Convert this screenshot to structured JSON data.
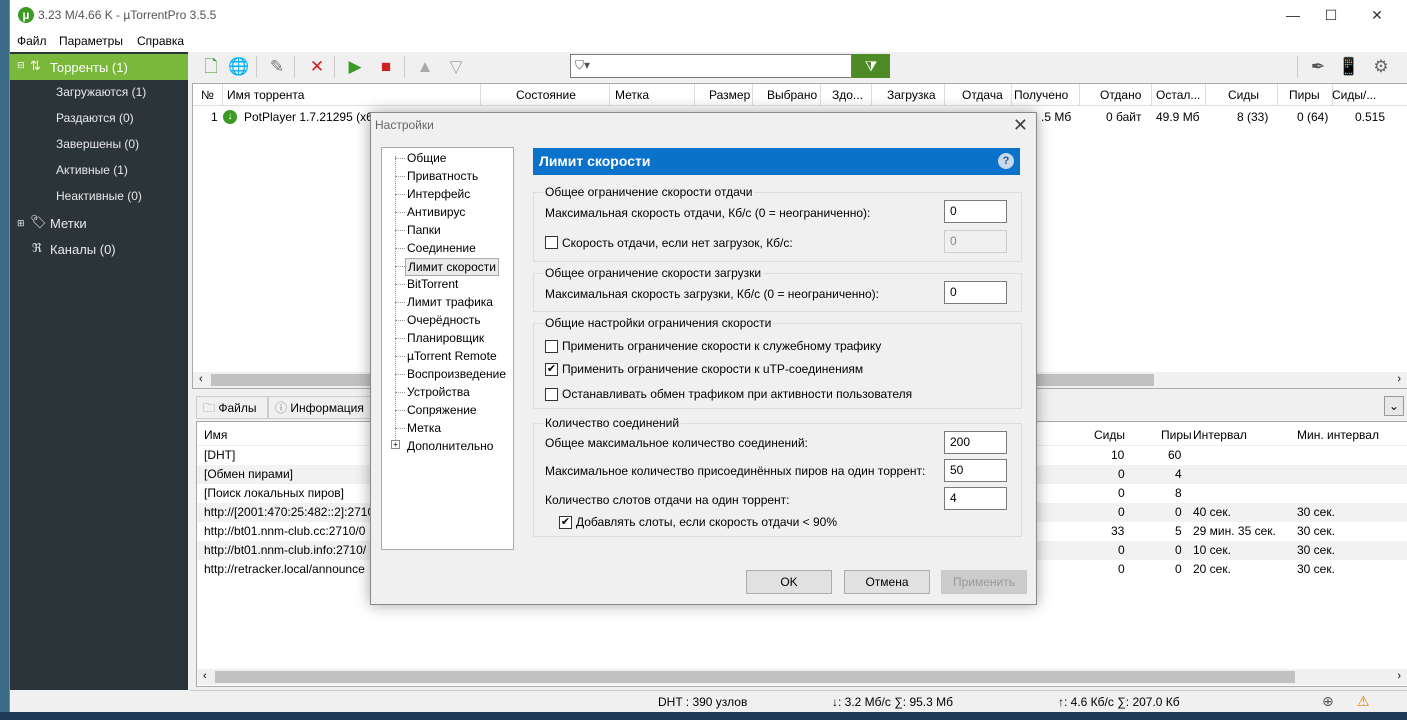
{
  "window": {
    "title": "3.23 M/4.66 K - µTorrentPro 3.5.5",
    "minimize": "—",
    "maximize": "☐",
    "close": "✕"
  },
  "menu": [
    "Файл",
    "Параметры",
    "Справка"
  ],
  "sidebar": {
    "torrents": "Торренты (1)",
    "items": [
      "Загружаются (1)",
      "Раздаются (0)",
      "Завершены (0)",
      "Активные (1)",
      "Неактивные (0)"
    ],
    "labels": "Метки",
    "feeds": "Каналы (0)"
  },
  "torrent_table": {
    "columns": [
      "№",
      "Имя торрента",
      "Состояние",
      "Метка",
      "Размер",
      "Выбрано",
      "Здо...",
      "Загрузка",
      "Отдача",
      "Получено",
      "Отдано",
      "Остал...",
      "Сиды",
      "Пиры",
      "Сиды/..."
    ],
    "row": {
      "num": "1",
      "name": "PotPlayer 1.7.21295 (x64)",
      "received": ".5 Мб",
      "sent": "0 байт",
      "remaining": "49.9 Мб",
      "seeds": "8 (33)",
      "peers": "0 (64)",
      "ratio": "0.515"
    }
  },
  "bottom_tabs": [
    "Файлы",
    "Информация"
  ],
  "peers_table": {
    "columns": [
      "Имя",
      "Сиды",
      "Пиры",
      "Интервал",
      "Мин. интервал"
    ],
    "rows": [
      {
        "name": "[DHT]",
        "seeds": "10",
        "peers": "60",
        "interval": "",
        "min": ""
      },
      {
        "name": "[Обмен пирами]",
        "seeds": "0",
        "peers": "4",
        "interval": "",
        "min": ""
      },
      {
        "name": "[Поиск локальных пиров]",
        "seeds": "0",
        "peers": "8",
        "interval": "",
        "min": ""
      },
      {
        "name": "http://[2001:470:25:482::2]:2710/",
        "seeds": "0",
        "peers": "0",
        "interval": "40 сек.",
        "min": "30 сек."
      },
      {
        "name": "http://bt01.nnm-club.cc:2710/0",
        "seeds": "33",
        "peers": "5",
        "interval": "29 мин. 35 сек.",
        "min": "30 сек."
      },
      {
        "name": "http://bt01.nnm-club.info:2710/",
        "seeds": "0",
        "peers": "0",
        "interval": "10 сек.",
        "min": "30 сек."
      },
      {
        "name": "http://retracker.local/announce",
        "seeds": "0",
        "peers": "0",
        "interval": "20 сек.",
        "min": "30 сек."
      }
    ]
  },
  "status": {
    "dht": "DHT : 390 узлов",
    "down": "↓: 3.2 Мб/с  ∑: 95.3 Мб",
    "up": "↑: 4.6 Кб/с  ∑: 207.0 Кб"
  },
  "dialog": {
    "title": "Настройки",
    "tree": [
      "Общие",
      "Приватность",
      "Интерфейс",
      "Антивирус",
      "Папки",
      "Соединение",
      "Лимит скорости",
      "BitTorrent",
      "Лимит трафика",
      "Очерёдность",
      "Планировщик",
      "µTorrent Remote",
      "Воспроизведение",
      "Устройства",
      "Сопряжение",
      "Метка",
      "Дополнительно"
    ],
    "header": "Лимит скорости",
    "help": "?",
    "upload_group": {
      "title": "Общее ограничение скорости отдачи",
      "max_label": "Максимальная скорость отдачи, Кб/с (0 = неограниченно):",
      "max_value": "0",
      "noload_label": "Скорость отдачи, если нет загрузок, Кб/с:",
      "noload_value": "0"
    },
    "download_group": {
      "title": "Общее ограничение скорости загрузки",
      "max_label": "Максимальная скорость загрузки, Кб/с (0 = неограниченно):",
      "max_value": "0"
    },
    "general_group": {
      "title": "Общие настройки ограничения скорости",
      "opt1": "Применить ограничение скорости к служебному трафику",
      "opt2": "Применить ограничение скорости к uTP-соединениям",
      "opt3": "Останавливать обмен трафиком при активности пользователя",
      "check": "✔"
    },
    "conn_group": {
      "title": "Количество соединений",
      "total_label": "Общее максимальное количество соединений:",
      "total_value": "200",
      "peers_label": "Максимальное количество присоединённых пиров на один торрент:",
      "peers_value": "50",
      "slots_label": "Количество слотов отдачи на один торрент:",
      "slots_value": "4",
      "extra_label": "Добавлять слоты, если скорость отдачи < 90%",
      "check": "✔"
    },
    "buttons": {
      "ok": "OK",
      "cancel": "Отмена",
      "apply": "Применить"
    }
  }
}
